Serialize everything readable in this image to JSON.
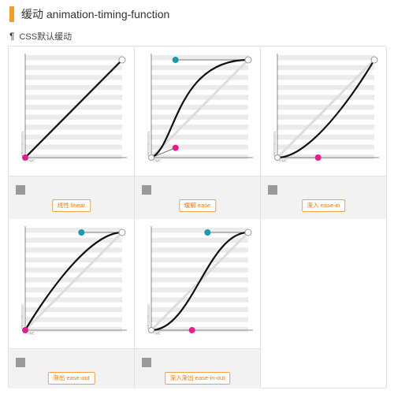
{
  "header": {
    "title": "缓动 animation-timing-function"
  },
  "section": {
    "pilcrow": "¶",
    "title": "CSS默认缓动"
  },
  "axis": {
    "y_label": "PROGRESSION",
    "x_label": "TIME"
  },
  "colors": {
    "accent": "#f39c2b",
    "curve": "#111111",
    "handle_start": "#e0218a",
    "handle_end": "#1a9aa6",
    "ref_line": "#dddddd",
    "stripe": "#ebebeb"
  },
  "cards": [
    {
      "label": "线性 linear",
      "p1": [
        0,
        0
      ],
      "p2": [
        1,
        1
      ],
      "show_p1": false,
      "show_p2": false
    },
    {
      "label": "缓解 ease",
      "p1": [
        0.25,
        0.1
      ],
      "p2": [
        0.25,
        1
      ],
      "show_p1": true,
      "show_p2": true
    },
    {
      "label": "渐入 ease-in",
      "p1": [
        0.42,
        0
      ],
      "p2": [
        1,
        1
      ],
      "show_p1": true,
      "show_p2": false
    },
    {
      "label": "渐出 ease-out",
      "p1": [
        0,
        0
      ],
      "p2": [
        0.58,
        1
      ],
      "show_p1": false,
      "show_p2": true
    },
    {
      "label": "渐入渐出 ease-in-out",
      "p1": [
        0.42,
        0
      ],
      "p2": [
        0.58,
        1
      ],
      "show_p1": true,
      "show_p2": true
    }
  ]
}
